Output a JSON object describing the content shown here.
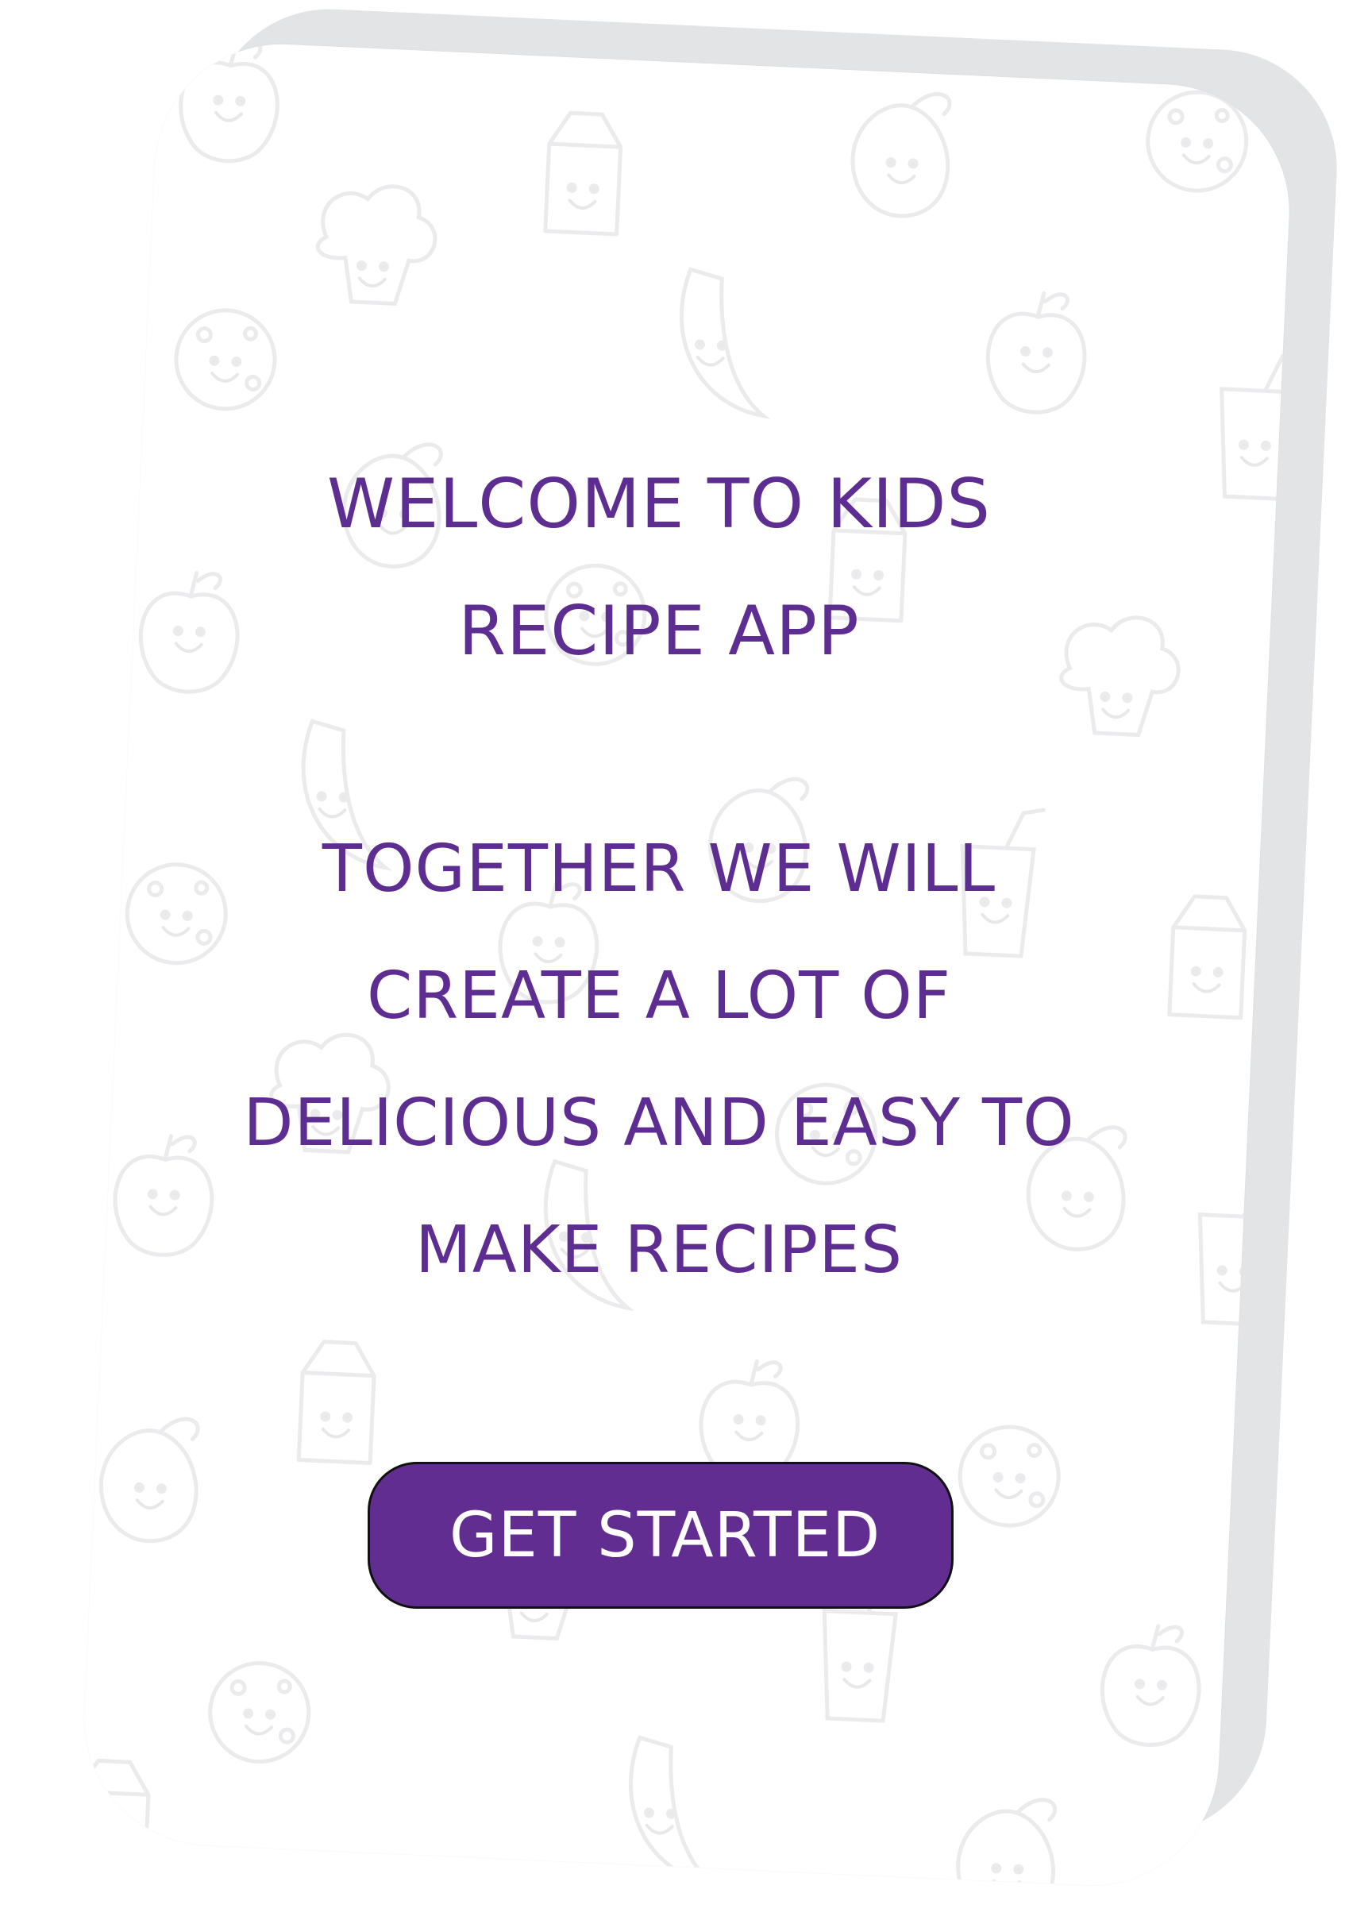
{
  "welcome": {
    "title_line1": "WELCOME TO KIDS",
    "title_line2": "RECIPE app"
  },
  "intro": {
    "line1": "TOGETHER WE WILL",
    "line2": "CREATE a LOT OF",
    "line3": "DELICIOUS and Easy TO",
    "line4": "Make RECIPES"
  },
  "cta": {
    "label": "get STARTED"
  },
  "colors": {
    "brand_purple": "#622d91",
    "text_purple": "#5e2d91",
    "card_background": "#ffffff",
    "card_shadow": "#e3e4e6",
    "doodle_pattern": "#ececee"
  },
  "background": {
    "pattern_icons": [
      "apple-doodle-icon",
      "mango-doodle-icon",
      "milk-carton-doodle-icon",
      "banana-doodle-icon",
      "cookie-doodle-icon",
      "donut-doodle-icon",
      "chicken-leg-doodle-icon",
      "broccoli-doodle-icon",
      "cup-doodle-icon",
      "egg-doodle-icon"
    ]
  }
}
